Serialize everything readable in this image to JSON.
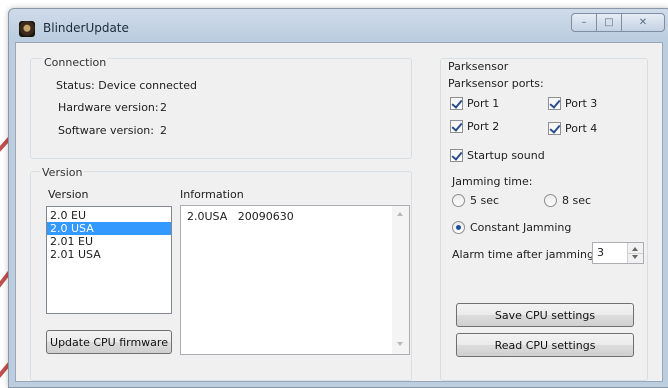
{
  "window": {
    "title": "BlinderUpdate"
  },
  "connection": {
    "group_label": "Connection",
    "status": "Status: Device connected",
    "hardware_label": "Hardware version:",
    "hardware_value": "2",
    "software_label": "Software version:",
    "software_value": "2"
  },
  "version": {
    "group_label": "Version",
    "list_header": "Version",
    "info_header": "Information",
    "items": [
      "2.0 EU",
      "2.0 USA",
      "2.01 EU",
      "2.01 USA"
    ],
    "selected_index": 1,
    "info_text": "2.0USA   20090630",
    "update_button": "Update CPU firmware"
  },
  "parksensor": {
    "group_label": "Parksensor",
    "ports_label": "Parksensor ports:",
    "ports": [
      {
        "label": "Port 1",
        "checked": true
      },
      {
        "label": "Port 3",
        "checked": true
      },
      {
        "label": "Port 2",
        "checked": true
      },
      {
        "label": "Port 4",
        "checked": true
      }
    ],
    "startup_sound": {
      "label": "Startup sound",
      "checked": true
    },
    "jamming_time_label": "Jamming time:",
    "radio_5sec": "5 sec",
    "radio_8sec": "8 sec",
    "radio_constant": "Constant Jamming",
    "alarm_label": "Alarm time after jamming:",
    "alarm_value": "3",
    "save_button": "Save CPU settings",
    "read_button": "Read CPU settings"
  },
  "colors": {
    "selection": "#3399ff",
    "annotation_line": "#c0504d"
  }
}
